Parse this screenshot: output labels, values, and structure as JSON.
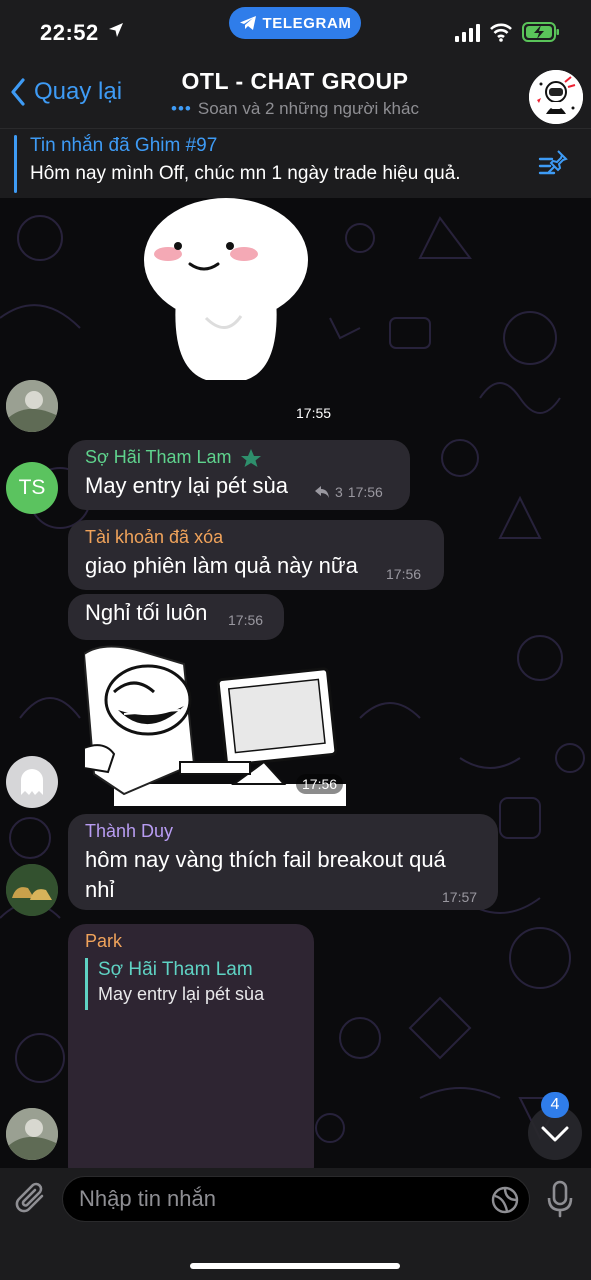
{
  "status_bar": {
    "time": "22:52",
    "app_pill": "TELEGRAM"
  },
  "header": {
    "back_label": "Quay lại",
    "title": "OTL - CHAT GROUP",
    "subtitle": "Soan và 2 những người khác"
  },
  "pinned": {
    "title": "Tin nhắn đã Ghim #97",
    "text": "Hôm nay mình Off, chúc mn 1 ngày trade hiệu quả."
  },
  "messages": {
    "sticker1_time": "17:55",
    "m1": {
      "avatar_initials": "TS",
      "sender": "Sợ Hãi Tham Lam",
      "text": "May entry lại pét sùa",
      "replies": "3",
      "time": "17:56"
    },
    "m2": {
      "sender": "Tài khoản đã xóa",
      "text": "giao phiên làm quả này nữa",
      "time": "17:56"
    },
    "m3": {
      "text": "Nghỉ tối luôn",
      "time": "17:56"
    },
    "sticker2_time": "17:56",
    "m4": {
      "sender": "Thành Duy",
      "text_line1": "hôm nay vàng thích fail breakout quá",
      "text_line2": "nhỉ",
      "time": "17:57"
    },
    "m5": {
      "sender": "Park",
      "reply_sender": "Sợ Hãi Tham Lam",
      "reply_text": "May entry lại pét sùa"
    }
  },
  "input": {
    "placeholder": "Nhập tin nhắn"
  },
  "scroll": {
    "unread_count": "4"
  },
  "colors": {
    "accent": "#3e9bf5",
    "bubble": "#2b2930",
    "sender_green": "#5fd38d",
    "sender_orange": "#f0a35b",
    "sender_purple": "#b89cf2",
    "sender_pink": "#ee7fa8"
  }
}
